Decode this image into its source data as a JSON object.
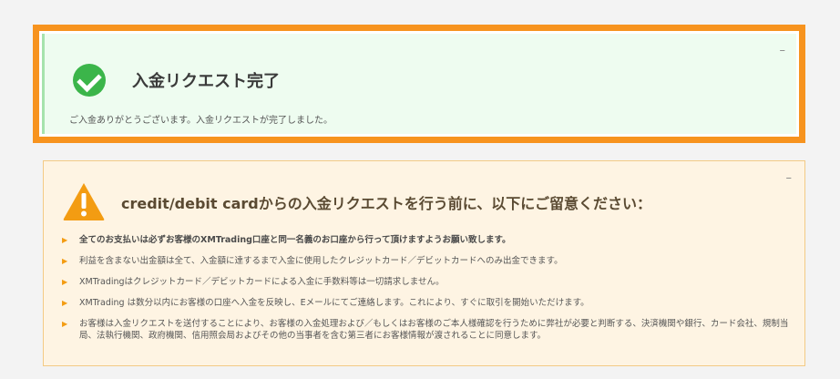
{
  "success": {
    "title": "入金リクエスト完了",
    "message": "ご入金ありがとうございます。入金リクエストが完了しました。",
    "collapse_label": "–",
    "icon": "check-circle-icon",
    "colors": {
      "border": "#f7931e",
      "background": "#eefcf0",
      "icon": "#3bb54a"
    }
  },
  "notice": {
    "title": "credit/debit cardからの入金リクエストを行う前に、以下にご留意ください：",
    "collapse_label": "–",
    "icon": "warning-triangle-icon",
    "bullet": "▶",
    "colors": {
      "background": "#fef4e3",
      "border": "#f3ca85",
      "icon": "#f39c12"
    },
    "items": [
      "全てのお支払いは必ずお客様のXMTrading口座と同一名義のお口座から行って頂けますようお願い致します。",
      "利益を含まない出金額は全て、入金額に達するまで入金に使用したクレジットカード／デビットカードへのみ出金できます。",
      "XMTradingはクレジットカード／デビットカードによる入金に手数料等は一切請求しません。",
      "XMTrading は数分以内にお客様の口座へ入金を反映し、Eメールにてご連絡します。これにより、すぐに取引を開始いただけます。",
      "お客様は入金リクエストを送付することにより、お客様の入金処理および／もしくはお客様のご本人様確認を行うために弊社が必要と判断する、決済機関や銀行、カード会社、規制当局、法執行機関、政府機関、信用照会局およびその他の当事者を含む第三者にお客様情報が渡されることに同意します。"
    ]
  }
}
